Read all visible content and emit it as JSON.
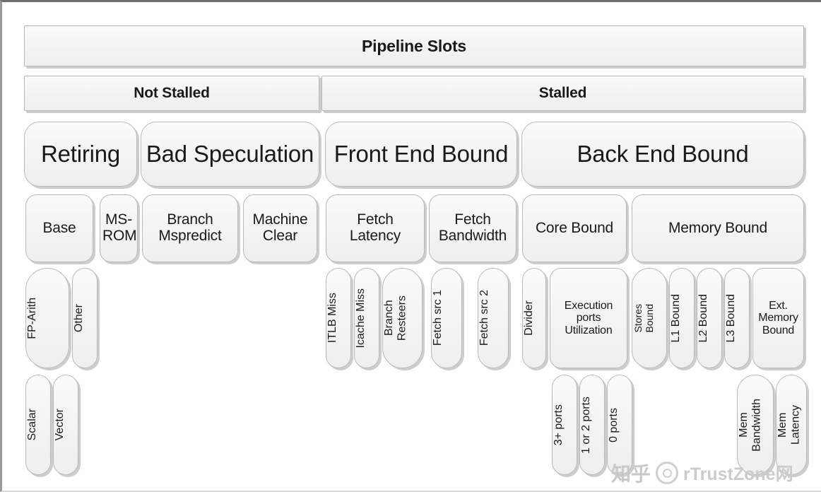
{
  "diagram": {
    "title": "Pipeline Slots",
    "root": {
      "label": "Pipeline Slots"
    },
    "stall_level": [
      {
        "label": "Not Stalled"
      },
      {
        "label": "Stalled"
      }
    ],
    "categories": [
      {
        "label": "Retiring"
      },
      {
        "label": "Bad Speculation"
      },
      {
        "label": "Front End Bound"
      },
      {
        "label": "Back End Bound"
      }
    ],
    "subcategories": [
      {
        "label": "Base"
      },
      {
        "label": "MS-\nROM"
      },
      {
        "label": "Branch\nMspredict"
      },
      {
        "label": "Machine\nClear"
      },
      {
        "label": "Fetch\nLatency"
      },
      {
        "label": "Fetch\nBandwidth"
      },
      {
        "label": "Core Bound"
      },
      {
        "label": "Memory Bound"
      }
    ],
    "leaves": [
      {
        "label": "FP-Arith"
      },
      {
        "label": "Other"
      },
      {
        "label": "ITLB Miss"
      },
      {
        "label": "Icache Miss"
      },
      {
        "label": "Branch\nResteers"
      },
      {
        "label": "Fetch src 1"
      },
      {
        "label": "Fetch src 2"
      },
      {
        "label": "Divider"
      },
      {
        "label": "Execution\nports\nUtilization"
      },
      {
        "label": "Stores\nBound"
      },
      {
        "label": "L1 Bound"
      },
      {
        "label": "L2 Bound"
      },
      {
        "label": "L3 Bound"
      },
      {
        "label": "Ext.\nMemory\nBound"
      }
    ],
    "sub_leaves": [
      {
        "label": "Scalar"
      },
      {
        "label": "Vector"
      },
      {
        "label": "3+ ports"
      },
      {
        "label": "1 or 2 ports"
      },
      {
        "label": "0 ports"
      },
      {
        "label": "Mem\nBandwidth"
      },
      {
        "label": "Mem\nLatency"
      }
    ]
  },
  "watermark": {
    "site": "知乎",
    "handle": "rTrustZone网"
  },
  "colors": {
    "page_background": "#ffffff",
    "box_fill_top": "#fbfbfb",
    "box_fill_bottom": "#efefef",
    "box_border": "#b9b9b9",
    "box_shadow": "#cdcdcd",
    "text": "#1a1a1a",
    "watermark": "#c9c9c9"
  }
}
